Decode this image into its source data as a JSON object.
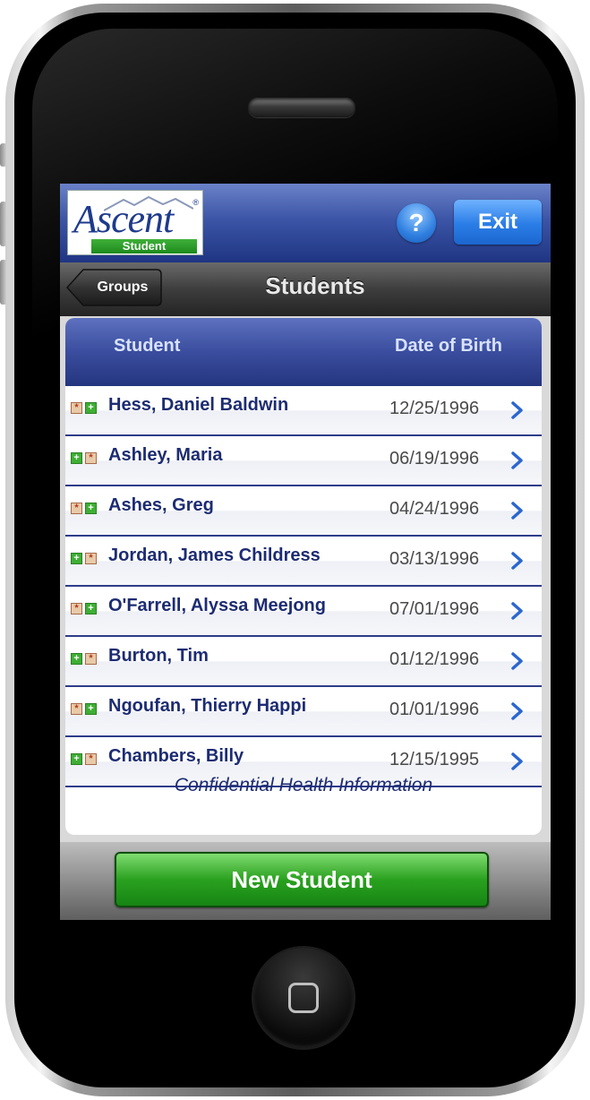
{
  "header": {
    "logo_text": "Ascent",
    "logo_sub": "Student",
    "logo_reg": "®",
    "help_label": "?",
    "exit_label": "Exit"
  },
  "nav": {
    "back_label": "Groups",
    "title": "Students"
  },
  "table": {
    "col_student": "Student",
    "col_dob": "Date of Birth",
    "rows": [
      {
        "name": "Hess, Daniel Baldwin",
        "dob": "12/25/1996",
        "icons": [
          "star-icon",
          "plus-icon"
        ]
      },
      {
        "name": "Ashley, Maria",
        "dob": "06/19/1996",
        "icons": [
          "plus-icon",
          "star-icon"
        ]
      },
      {
        "name": "Ashes, Greg",
        "dob": "04/24/1996",
        "icons": [
          "star-icon",
          "plus-icon"
        ]
      },
      {
        "name": "Jordan, James Childress",
        "dob": "03/13/1996",
        "icons": [
          "plus-icon",
          "star-icon"
        ]
      },
      {
        "name": "O'Farrell, Alyssa Meejong",
        "dob": "07/01/1996",
        "icons": [
          "star-icon",
          "plus-icon"
        ]
      },
      {
        "name": "Burton, Tim",
        "dob": "01/12/1996",
        "icons": [
          "plus-icon",
          "star-icon"
        ]
      },
      {
        "name": "Ngoufan, Thierry Happi",
        "dob": "01/01/1996",
        "icons": [
          "star-icon",
          "plus-icon"
        ]
      },
      {
        "name": "Chambers, Billy",
        "dob": "12/15/1995",
        "icons": [
          "plus-icon",
          "star-icon"
        ]
      }
    ],
    "footer_note": "Confidential Health Information"
  },
  "bottom": {
    "new_student_label": "New Student"
  },
  "colors": {
    "header_blue": "#3c55a6",
    "name_text": "#1d2c72",
    "new_button_green": "#2aa11f",
    "exit_blue": "#2a7de6"
  }
}
